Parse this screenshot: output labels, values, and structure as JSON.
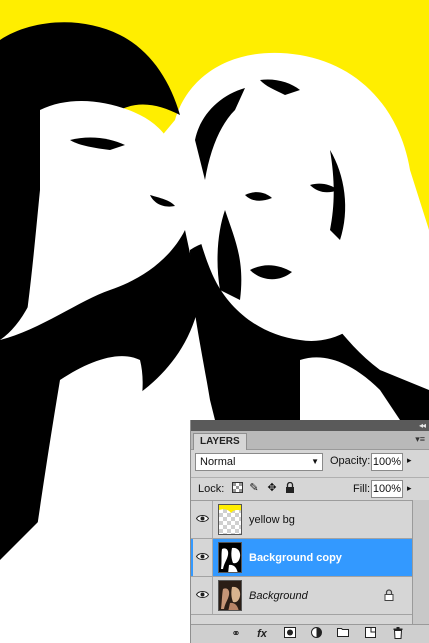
{
  "canvas": {
    "background_color": "#ffee00"
  },
  "layers_panel": {
    "tab_label": "LAYERS",
    "blend_mode": "Normal",
    "opacity_label": "Opacity:",
    "opacity_value": "100%",
    "lock_label": "Lock:",
    "fill_label": "Fill:",
    "fill_value": "100%",
    "layers": [
      {
        "name": "yellow bg",
        "visible": true,
        "selected": false
      },
      {
        "name": "Background copy",
        "visible": true,
        "selected": true
      },
      {
        "name": "Background",
        "visible": true,
        "selected": false,
        "locked": true
      }
    ],
    "bottom_icons": [
      "link-layers-icon",
      "fx-icon",
      "add-mask-icon",
      "adjustment-layer-icon",
      "new-group-icon",
      "new-layer-icon",
      "trash-icon"
    ]
  },
  "colors": {
    "selection": "#3399ff",
    "panel": "#d6d6d6",
    "yellow": "#ffee00"
  }
}
